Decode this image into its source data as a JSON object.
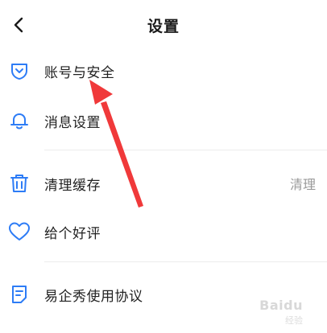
{
  "header": {
    "title": "设置",
    "back_icon": "chevron-left-icon"
  },
  "menu": {
    "items": [
      {
        "label": "账号与安全",
        "icon": "shield-icon"
      },
      {
        "label": "消息设置",
        "icon": "bell-icon"
      },
      {
        "label": "清理缓存",
        "icon": "trash-icon",
        "action": "清理"
      },
      {
        "label": "给个好评",
        "icon": "heart-icon"
      },
      {
        "label": "易企秀使用协议",
        "icon": "document-icon"
      }
    ]
  },
  "colors": {
    "accent": "#2d7cf6",
    "annotation_arrow": "#f0393a"
  },
  "watermark": {
    "text": "Baidu",
    "sub": "经验"
  }
}
